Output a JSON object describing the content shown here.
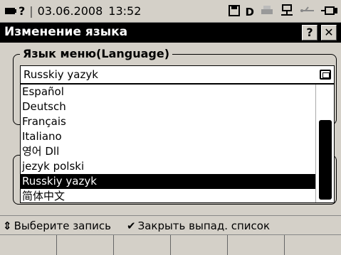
{
  "status_bar": {
    "battery_icon": "battery-icon",
    "help_glyph": "?",
    "date": "03.06.2008",
    "time": "13:52",
    "icons": [
      "save-icon",
      "d-drive-icon",
      "printer-icon",
      "network-icon",
      "usb-icon",
      "plug-icon"
    ],
    "d_label": "D"
  },
  "title_bar": {
    "title": "Изменение языка",
    "help_label": "?",
    "close_label": "✕"
  },
  "language_group": {
    "label": "Язык меню(Language)",
    "current_value": "Russkiy yazyk"
  },
  "dropdown": {
    "options": [
      {
        "label": "Español"
      },
      {
        "label": "Deutsch"
      },
      {
        "label": "Français"
      },
      {
        "label": "Italiano"
      },
      {
        "label": "영어 Dll"
      },
      {
        "label": "jezyk polski"
      },
      {
        "label": "Russkiy yazyk"
      },
      {
        "label": "简体中文"
      }
    ],
    "selected_index": 6
  },
  "hint_bar": {
    "hint1_glyph": "⇕",
    "hint1_text": "Выберите запись",
    "hint2_glyph": "✔",
    "hint2_text": "Закрыть выпад. список"
  },
  "softkeys": [
    "",
    "",
    "",
    "",
    "",
    ""
  ]
}
